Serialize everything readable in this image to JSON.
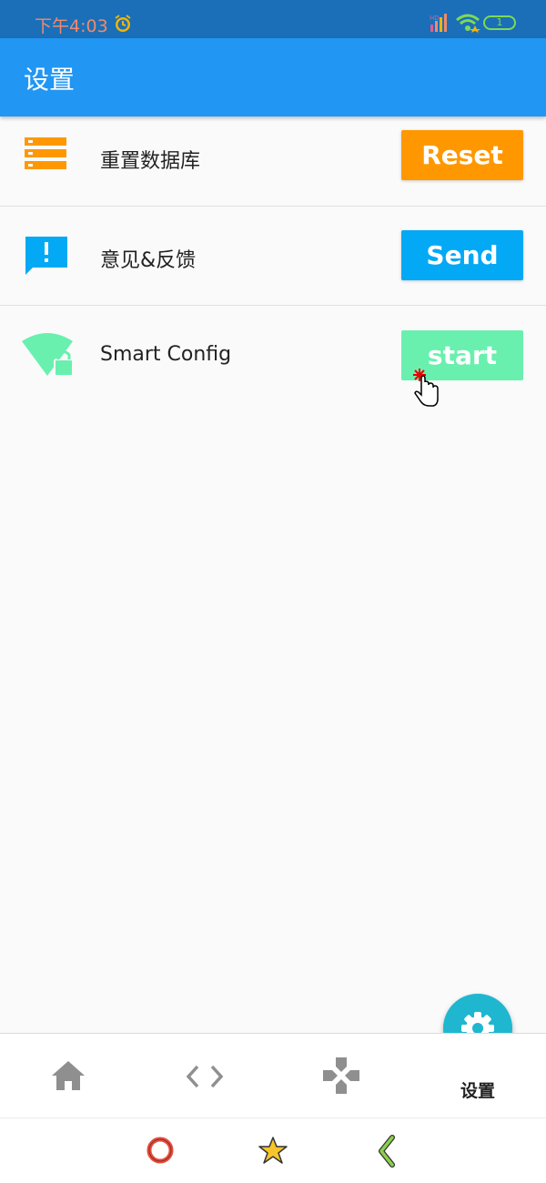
{
  "status_bar": {
    "time": "下午4:03",
    "battery": "1",
    "signal_label": "HD"
  },
  "app_bar": {
    "title": "设置"
  },
  "settings": [
    {
      "label": "重置数据库",
      "button": "Reset",
      "icon": "storage-icon",
      "color": "#ff9800"
    },
    {
      "label": "意见&反馈",
      "button": "Send",
      "icon": "feedback-icon",
      "color": "#03a9f4"
    },
    {
      "label": "Smart Config",
      "button": "start",
      "icon": "wifi-lock-icon",
      "color": "#69f0ae"
    }
  ],
  "bottom_nav": {
    "items": [
      {
        "icon": "home-icon"
      },
      {
        "icon": "code-icon"
      },
      {
        "icon": "gamepad-icon"
      },
      {
        "icon": "gear-icon",
        "label": "设置"
      }
    ],
    "accent": "#1eb7cf"
  },
  "system_nav": {
    "icons": [
      "circle-icon",
      "star-icon",
      "back-chevron-icon"
    ]
  }
}
